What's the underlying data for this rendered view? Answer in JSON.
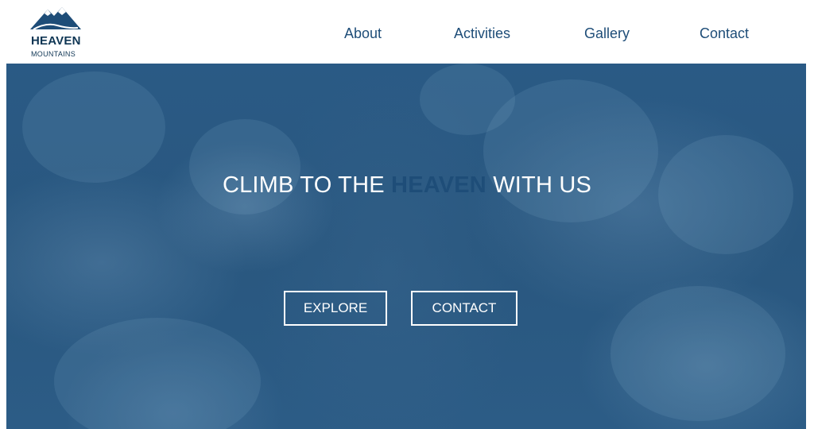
{
  "logo": {
    "name": "HEAVEN",
    "subtitle": "MOUNTAINS",
    "icon": "mountain-icon"
  },
  "nav": {
    "items": [
      "About",
      "Activities",
      "Gallery",
      "Contact"
    ]
  },
  "hero": {
    "title_pre": "CLIMB TO THE ",
    "title_accent": "HEAVEN",
    "title_post": " WITH US",
    "buttons": {
      "explore": "EXPLORE",
      "contact": "CONTACT"
    }
  },
  "colors": {
    "brand": "#1e4d78",
    "hero_overlay": "#2a5a85",
    "white": "#ffffff"
  }
}
